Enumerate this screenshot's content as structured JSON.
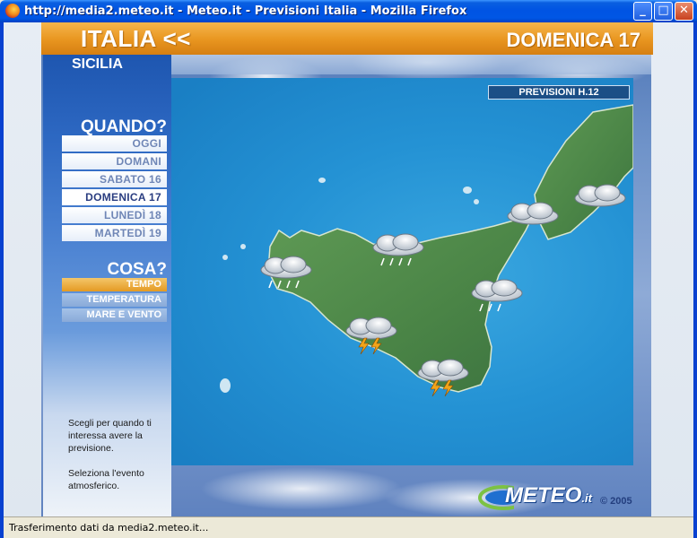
{
  "window": {
    "title": "http://media2.meteo.it - Meteo.it - Previsioni Italia - Mozilla Firefox",
    "min_glyph": "_",
    "max_glyph": "□",
    "close_glyph": "✕"
  },
  "header": {
    "left": "ITALIA <<",
    "right": "DOMENICA 17"
  },
  "region": "SICILIA",
  "quando": {
    "heading": "QUANDO?",
    "days": [
      {
        "label": "OGGI",
        "active": false
      },
      {
        "label": "DOMANI",
        "active": false
      },
      {
        "label": "SABATO 16",
        "active": false
      },
      {
        "label": "DOMENICA 17",
        "active": true
      },
      {
        "label": "LUNEDÌ 18",
        "active": false
      },
      {
        "label": "MARTEDÌ 19",
        "active": false
      }
    ]
  },
  "cosa": {
    "heading": "COSA?",
    "options": [
      {
        "label": "TEMPO",
        "active": true
      },
      {
        "label": "TEMPERATURA",
        "active": false
      },
      {
        "label": "MARE E VENTO",
        "active": false
      }
    ]
  },
  "help": {
    "line1": "Scegli per quando ti interessa avere la previsione.",
    "line2": "Seleziona l'evento atmosferico."
  },
  "map": {
    "label": "PREVISIONI H.12",
    "icons": [
      {
        "type": "rain-cloud-icon"
      },
      {
        "type": "rain-cloud-icon"
      },
      {
        "type": "rain-cloud-icon"
      },
      {
        "type": "rain-cloud-icon"
      },
      {
        "type": "cloud-icon"
      },
      {
        "type": "thunderstorm-icon"
      },
      {
        "type": "thunderstorm-icon"
      }
    ]
  },
  "logo": {
    "text": "METEO",
    "suffix": ".it",
    "copyright": "© 2005"
  },
  "status": {
    "text": "Trasferimento dati da media2.meteo.it..."
  },
  "colors": {
    "header_orange": "#e8951f",
    "left_blue": "#2d68c2",
    "sea_blue": "#2492d4",
    "land_green": "#4f8a4a"
  }
}
